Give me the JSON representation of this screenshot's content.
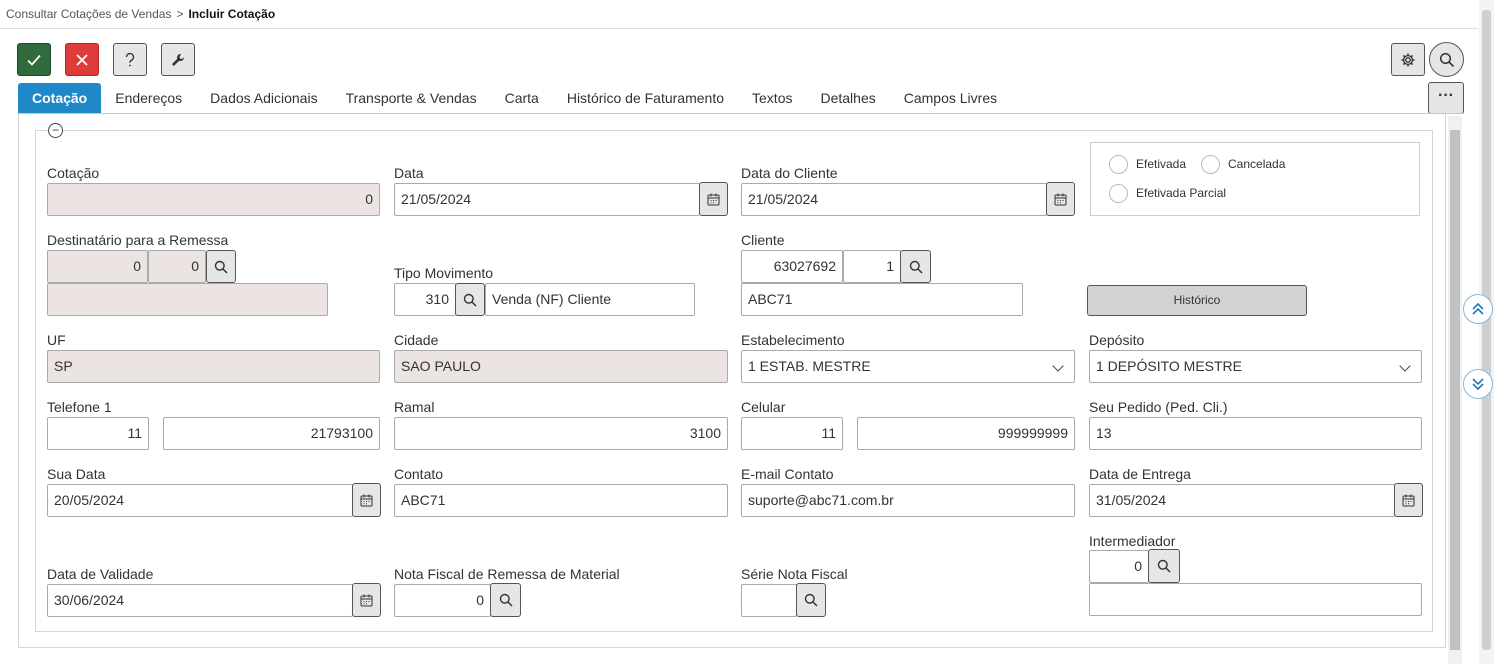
{
  "breadcrumb": {
    "parent": "Consultar Cotações de Vendas",
    "separator": ">",
    "current": "Incluir Cotação"
  },
  "tabs": [
    "Cotação",
    "Endereços",
    "Dados Adicionais",
    "Transporte & Vendas",
    "Carta",
    "Histórico de Faturamento",
    "Textos",
    "Detalhes",
    "Campos Livres"
  ],
  "more_label": "···",
  "form": {
    "cotacao": {
      "label": "Cotação",
      "value": "0"
    },
    "data": {
      "label": "Data",
      "value": "21/05/2024"
    },
    "data_cliente": {
      "label": "Data do Cliente",
      "value": "21/05/2024"
    },
    "status": {
      "efetivada": "Efetivada",
      "cancelada": "Cancelada",
      "parcial": "Efetivada Parcial"
    },
    "destinatario": {
      "label": "Destinatário para a Remessa",
      "v1": "0",
      "v2": "0",
      "name": ""
    },
    "tipo_movimento": {
      "label": "Tipo Movimento",
      "code": "310",
      "desc": "Venda (NF) Cliente"
    },
    "cliente": {
      "label": "Cliente",
      "code": "63027692",
      "seq": "1",
      "name": "ABC71"
    },
    "historico_label": "Histórico",
    "uf": {
      "label": "UF",
      "value": "SP"
    },
    "cidade": {
      "label": "Cidade",
      "value": "SAO PAULO"
    },
    "estabelecimento": {
      "label": "Estabelecimento",
      "value": "1 ESTAB. MESTRE"
    },
    "deposito": {
      "label": "Depósito",
      "value": "1 DEPÓSITO MESTRE"
    },
    "telefone": {
      "label": "Telefone 1",
      "ddd": "11",
      "number": "21793100"
    },
    "ramal": {
      "label": "Ramal",
      "value": "3100"
    },
    "celular": {
      "label": "Celular",
      "ddd": "11",
      "number": "999999999"
    },
    "seu_pedido": {
      "label": "Seu Pedido (Ped. Cli.)",
      "value": "13"
    },
    "sua_data": {
      "label": "Sua Data",
      "value": "20/05/2024"
    },
    "contato": {
      "label": "Contato",
      "value": "ABC71"
    },
    "email": {
      "label": "E-mail Contato",
      "value": "suporte@abc71.com.br"
    },
    "data_entrega": {
      "label": "Data de Entrega",
      "value": "31/05/2024"
    },
    "intermediador": {
      "label": "Intermediador",
      "value": "0",
      "name": ""
    },
    "data_validade": {
      "label": "Data de Validade",
      "value": "30/06/2024"
    },
    "nf_remessa": {
      "label": "Nota Fiscal de Remessa de Material",
      "value": "0"
    },
    "serie_nf": {
      "label": "Série Nota Fiscal",
      "value": ""
    }
  },
  "colors": {
    "accent": "#1e88c8",
    "confirm": "#2f6b3c",
    "cancel": "#e03b3b",
    "readonly_bg": "#ece3e3"
  }
}
